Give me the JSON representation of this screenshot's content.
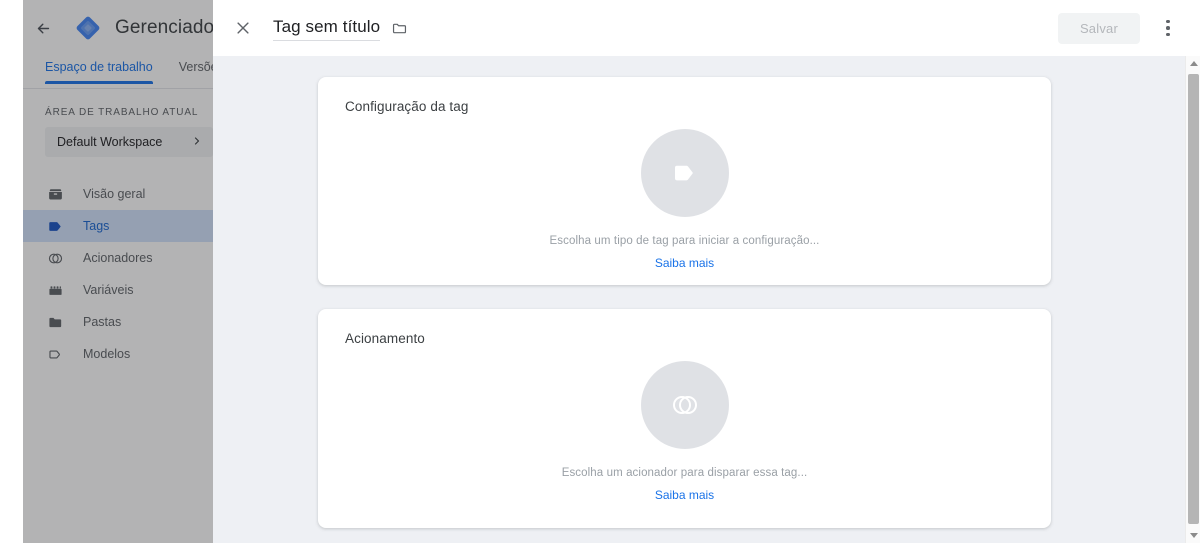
{
  "app": {
    "brand_title": "Gerenciador d",
    "back_icon": "back-arrow-icon",
    "logo_icon": "gtm-logo-icon"
  },
  "tabs": [
    {
      "label": "Espaço de trabalho",
      "active": true
    },
    {
      "label": "Versõe",
      "active": false
    }
  ],
  "workspace": {
    "section_label": "ÁREA DE TRABALHO ATUAL",
    "name": "Default Workspace",
    "chevron": "›"
  },
  "nav": {
    "items": [
      {
        "label": "Visão geral",
        "icon": "overview-icon",
        "selected": false
      },
      {
        "label": "Tags",
        "icon": "tag-icon",
        "selected": true
      },
      {
        "label": "Acionadores",
        "icon": "trigger-icon",
        "selected": false
      },
      {
        "label": "Variáveis",
        "icon": "variables-icon",
        "selected": false
      },
      {
        "label": "Pastas",
        "icon": "folder-icon",
        "selected": false
      },
      {
        "label": "Modelos",
        "icon": "template-icon",
        "selected": false
      }
    ]
  },
  "dialog": {
    "close_icon": "close-icon",
    "title": "Tag sem título",
    "title_folder_icon": "folder-icon",
    "save_label": "Salvar",
    "save_disabled": true,
    "menu_icon": "more-vert-icon",
    "cards": [
      {
        "title": "Configuração da tag",
        "icon": "tag-outline-icon",
        "empty_text": "Escolha um tipo de tag para iniciar a configuração...",
        "link_label": "Saiba mais"
      },
      {
        "title": "Acionamento",
        "icon": "trigger-outline-icon",
        "empty_text": "Escolha um acionador para disparar essa tag...",
        "link_label": "Saiba mais"
      }
    ]
  },
  "scrollbar": {
    "up_icon": "scroll-up-arrow-icon",
    "down_icon": "scroll-down-arrow-icon"
  },
  "colors": {
    "accent_blue": "#1a73e8",
    "selected_nav_bg": "#d2e3fc",
    "backdrop": "#eef0f4",
    "empty_circle": "#dfe1e5",
    "muted_text": "#9aa0a6"
  }
}
